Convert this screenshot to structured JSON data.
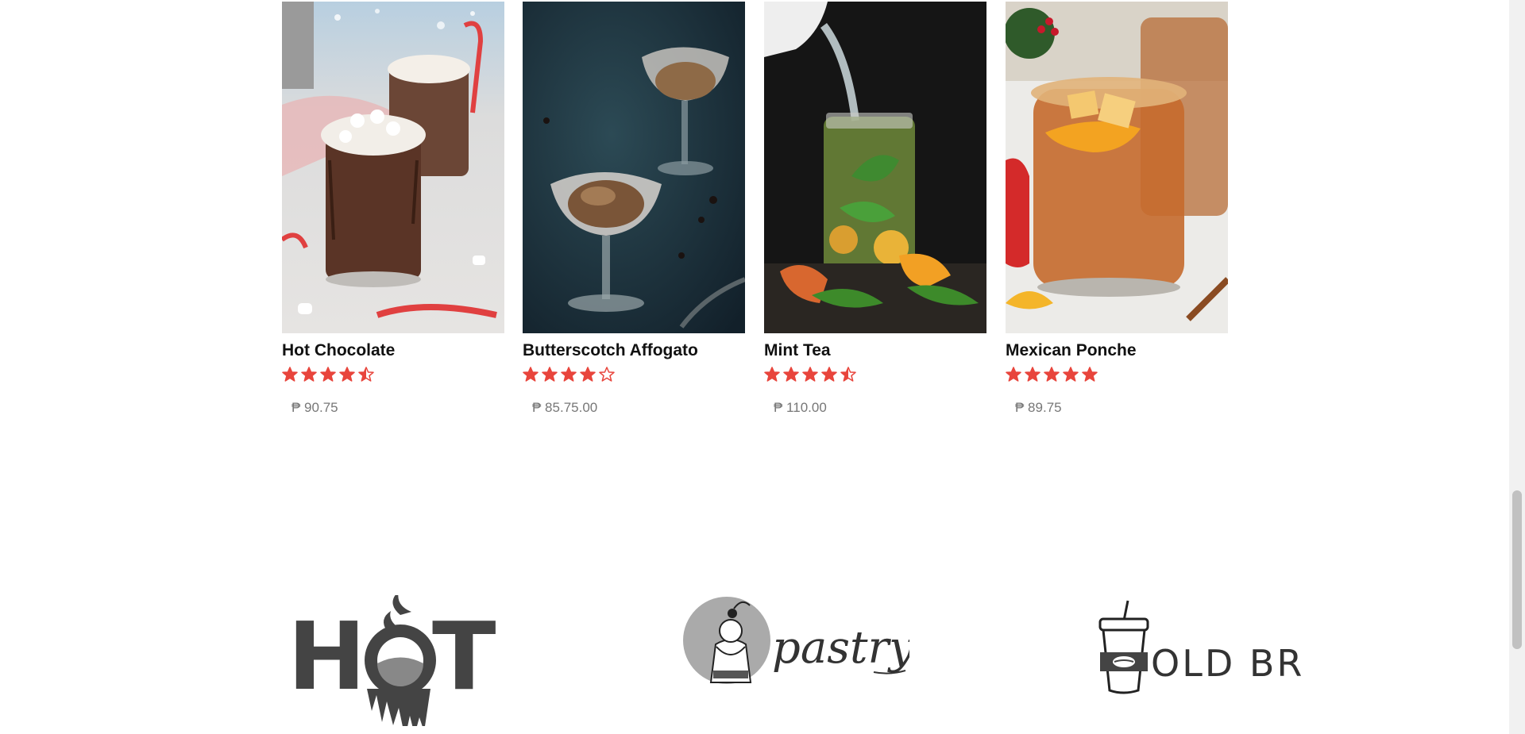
{
  "products": [
    {
      "name": "Hot Chocolate",
      "rating": 4.5,
      "price": "₱ 90.75",
      "image": "hot-chocolate-photo"
    },
    {
      "name": "Butterscotch Affogato",
      "rating": 4,
      "price": "₱ 85.75.00",
      "image": "affogato-photo"
    },
    {
      "name": "Mint Tea",
      "rating": 4.5,
      "price": "₱ 110.00",
      "image": "mint-tea-photo"
    },
    {
      "name": "Mexican Ponche",
      "rating": 5,
      "price": "₱ 89.75",
      "image": "ponche-photo"
    }
  ],
  "brands": [
    {
      "name": "HOT",
      "icon": "hot-logo"
    },
    {
      "name": "pastry",
      "icon": "pastry-logo"
    },
    {
      "name": "OLD BREW",
      "icon": "cold-brew-logo"
    }
  ],
  "colors": {
    "star": "#e8453c",
    "logo": "#444444"
  }
}
